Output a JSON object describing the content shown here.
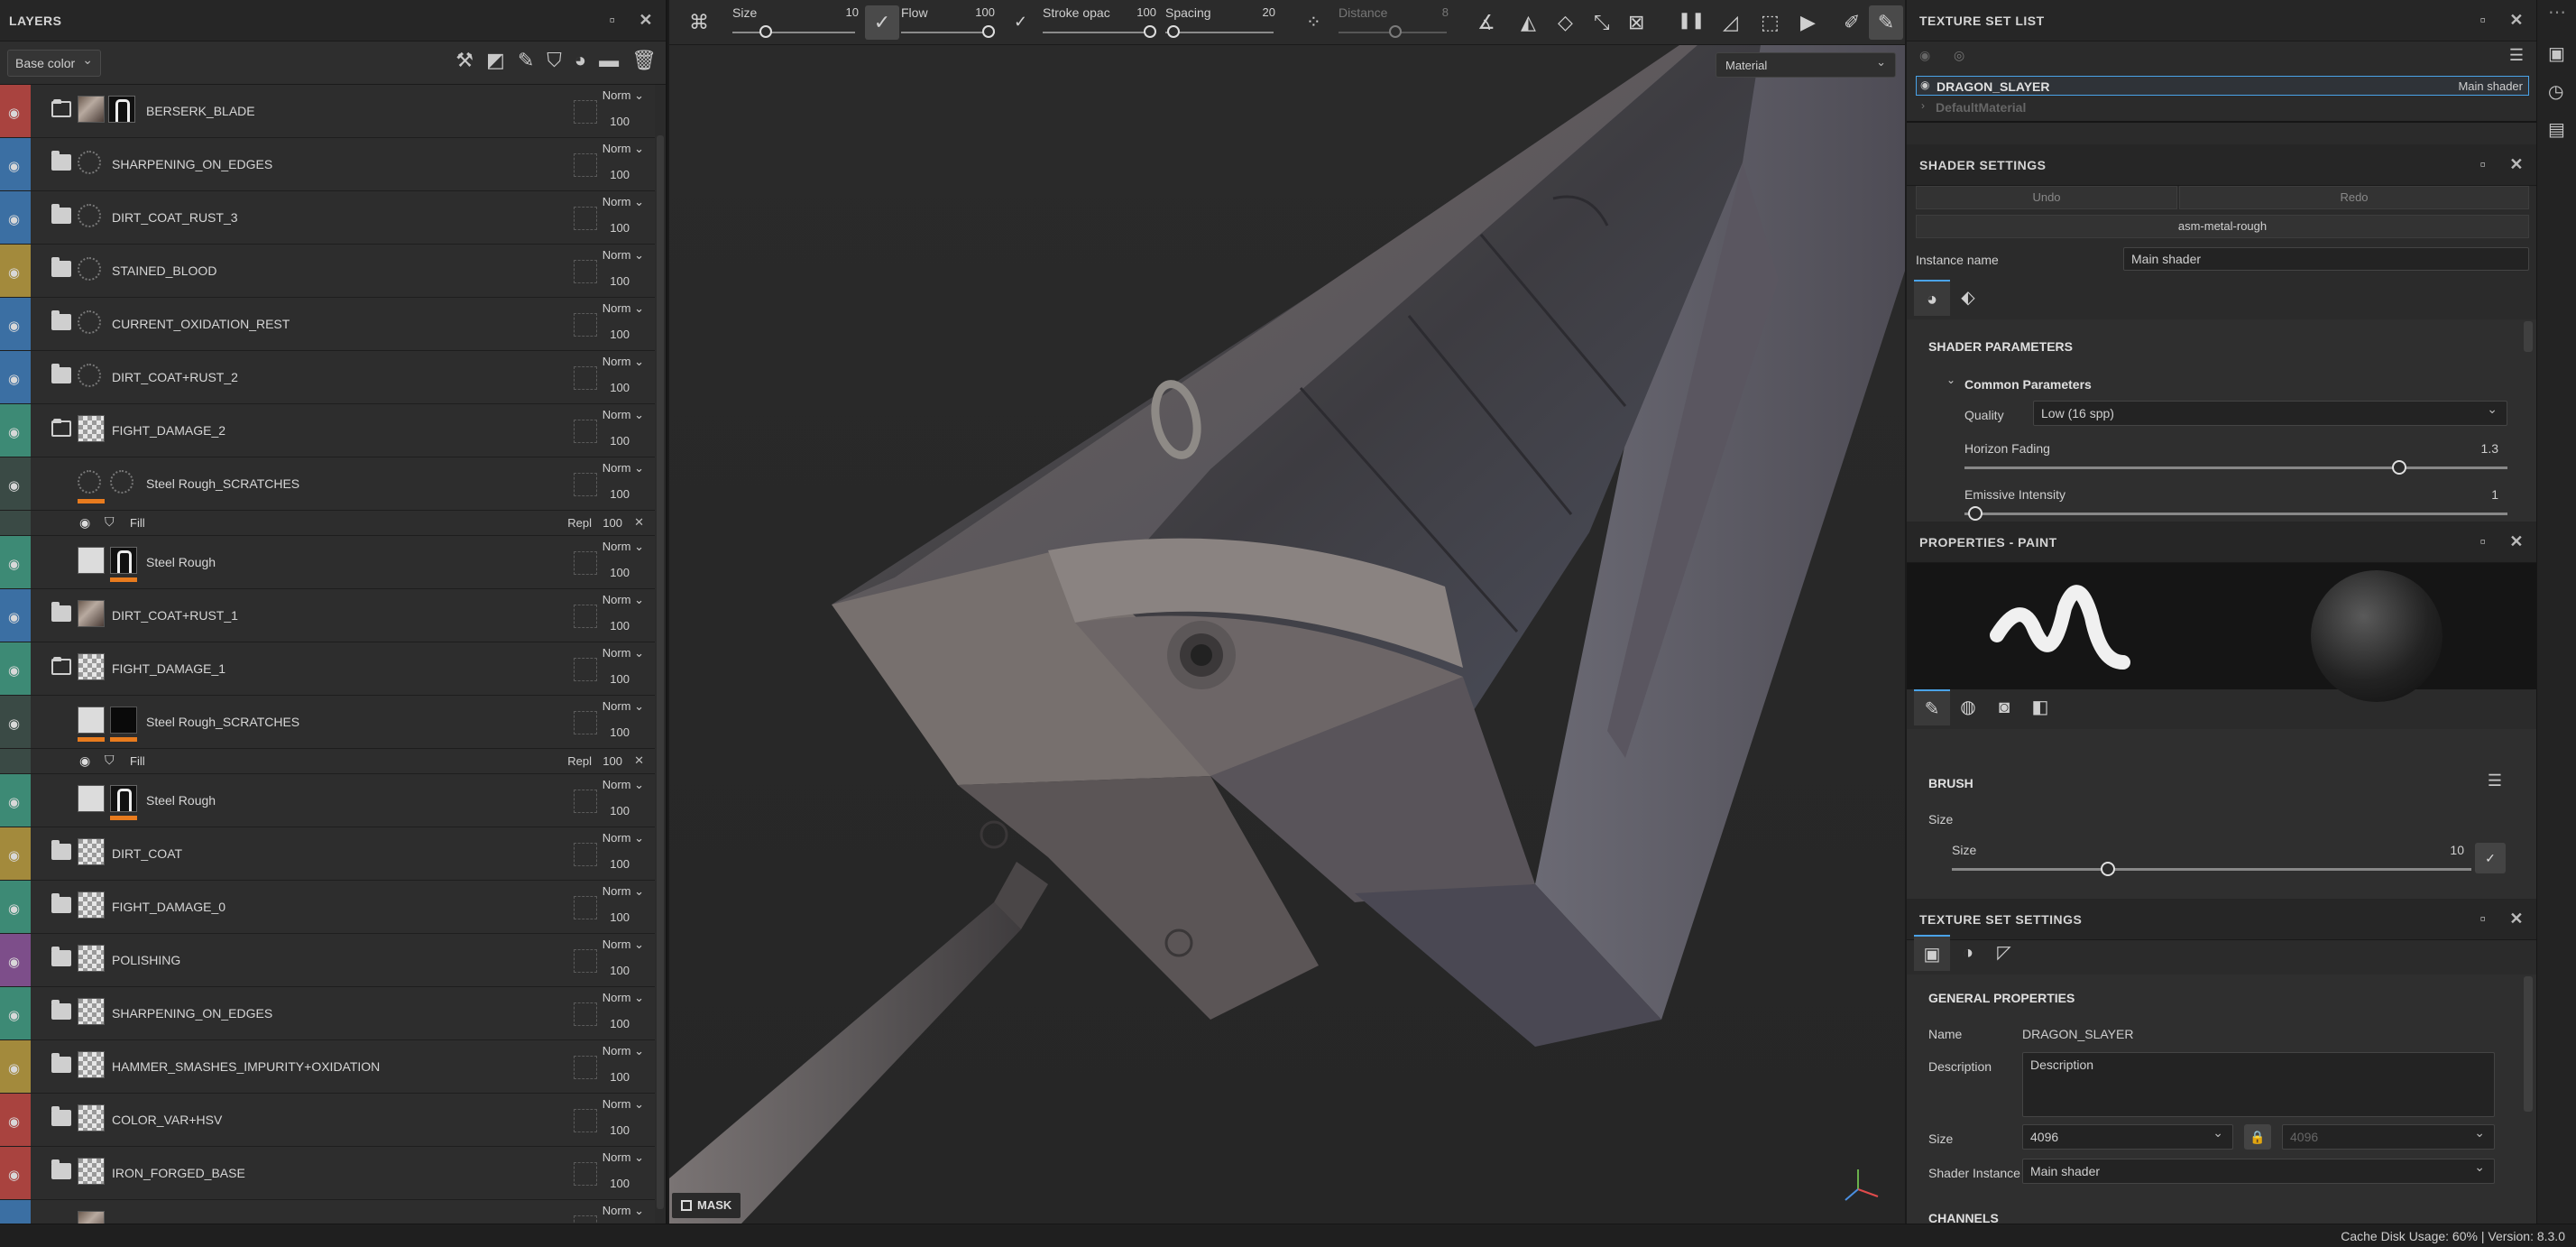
{
  "layers_panel": {
    "title": "LAYERS",
    "channel": "Base color",
    "layers": [
      {
        "name": "BERSERK_BLADE",
        "color": "#a9433f",
        "kind": "folder-open",
        "thumb": "pic",
        "mask": true,
        "blend": "Norm",
        "opacity": "100"
      },
      {
        "name": "SHARPENING_ON_EDGES",
        "color": "#3b6fa3",
        "kind": "folder",
        "thumb": "ring",
        "blend": "Norm",
        "opacity": "100"
      },
      {
        "name": "DIRT_COAT_RUST_3",
        "color": "#3b6fa3",
        "kind": "folder",
        "thumb": "ring",
        "blend": "Norm",
        "opacity": "100"
      },
      {
        "name": "STAINED_BLOOD",
        "color": "#a38a3c",
        "kind": "folder",
        "thumb": "ring",
        "blend": "Norm",
        "opacity": "100"
      },
      {
        "name": "CURRENT_OXIDATION_REST",
        "color": "#3b6fa3",
        "kind": "folder",
        "thumb": "ring",
        "blend": "Norm",
        "opacity": "100"
      },
      {
        "name": "DIRT_COAT+RUST_2",
        "color": "#3b6fa3",
        "kind": "folder",
        "thumb": "ring",
        "blend": "Norm",
        "opacity": "100"
      },
      {
        "name": "FIGHT_DAMAGE_2",
        "color": "#3d8a75",
        "kind": "folder-open",
        "thumb": "checker",
        "blend": "Norm",
        "opacity": "100"
      },
      {
        "name": "Steel Rough_SCRATCHES",
        "color": "#3a4a45",
        "kind": "fill-layer",
        "thumb": "ring",
        "thumb2": "ring",
        "orange": true,
        "blend": "Norm",
        "opacity": "100"
      },
      {
        "sub": true,
        "name": "Fill",
        "blend": "Repl",
        "opacity": "100"
      },
      {
        "name": "Steel Rough",
        "color": "#3d8a75",
        "kind": "layer",
        "thumb": "white",
        "thumb2": "mask",
        "orange2": true,
        "blend": "Norm",
        "opacity": "100"
      },
      {
        "name": "DIRT_COAT+RUST_1",
        "color": "#3b6fa3",
        "kind": "folder",
        "thumb": "pic",
        "blend": "Norm",
        "opacity": "100"
      },
      {
        "name": "FIGHT_DAMAGE_1",
        "color": "#3d8a75",
        "kind": "folder-open",
        "thumb": "checker",
        "blend": "Norm",
        "opacity": "100"
      },
      {
        "name": "Steel Rough_SCRATCHES",
        "color": "#3a4a45",
        "kind": "fill-layer",
        "thumb": "white",
        "thumb2": "dark",
        "orange": true,
        "orange2": true,
        "blend": "Norm",
        "opacity": "100"
      },
      {
        "sub": true,
        "name": "Fill",
        "blend": "Repl",
        "opacity": "100"
      },
      {
        "name": "Steel Rough",
        "color": "#3d8a75",
        "kind": "layer",
        "thumb": "white",
        "thumb2": "mask",
        "orange2": true,
        "blend": "Norm",
        "opacity": "100"
      },
      {
        "name": "DIRT_COAT",
        "color": "#a38a3c",
        "kind": "folder",
        "thumb": "checker",
        "blend": "Norm",
        "opacity": "100"
      },
      {
        "name": "FIGHT_DAMAGE_0",
        "color": "#3d8a75",
        "kind": "folder",
        "thumb": "checker",
        "blend": "Norm",
        "opacity": "100"
      },
      {
        "name": "POLISHING",
        "color": "#7d4e8a",
        "kind": "folder",
        "thumb": "checker",
        "blend": "Norm",
        "opacity": "100"
      },
      {
        "name": "SHARPENING_ON_EDGES",
        "color": "#3d8a75",
        "kind": "folder",
        "thumb": "checker",
        "blend": "Norm",
        "opacity": "100"
      },
      {
        "name": "HAMMER_SMASHES_IMPURITY+OXIDATION",
        "color": "#a38a3c",
        "kind": "folder",
        "thumb": "checker",
        "blend": "Norm",
        "opacity": "100"
      },
      {
        "name": "COLOR_VAR+HSV",
        "color": "#a9433f",
        "kind": "folder",
        "thumb": "checker",
        "blend": "Norm",
        "opacity": "100"
      },
      {
        "name": "IRON_FORGED_BASE",
        "color": "#a9433f",
        "kind": "folder",
        "thumb": "checker",
        "blend": "Norm",
        "opacity": "100"
      },
      {
        "name": "",
        "color": "#3b6fa3",
        "kind": "layer",
        "thumb": "pic",
        "blend": "Norm",
        "opacity": ""
      }
    ]
  },
  "toolbar": {
    "size_label": "Size",
    "size_value": "10",
    "flow_label": "Flow",
    "flow_value": "100",
    "stroke_label": "Stroke opac",
    "stroke_value": "100",
    "spacing_label": "Spacing",
    "spacing_value": "20",
    "distance_label": "Distance",
    "distance_value": "8"
  },
  "viewport": {
    "material_mode": "Material",
    "mask_label": "MASK"
  },
  "texture_set_list": {
    "title": "TEXTURE SET LIST",
    "items": [
      {
        "name": "DRAGON_SLAYER",
        "shader": "Main shader"
      },
      {
        "name": "DefaultMaterial",
        "shader": ""
      }
    ]
  },
  "shader_settings": {
    "title": "SHADER SETTINGS",
    "undo": "Undo",
    "redo": "Redo",
    "shader": "asm-metal-rough",
    "instance_label": "Instance name",
    "instance_value": "Main shader",
    "params_title": "SHADER PARAMETERS",
    "common": "Common Parameters",
    "quality_label": "Quality",
    "quality_value": "Low (16 spp)",
    "horizon_label": "Horizon Fading",
    "horizon_value": "1.3",
    "horizon_level": 0.8,
    "emissive_label": "Emissive Intensity",
    "emissive_value": "1",
    "emissive_level": 0.02
  },
  "properties_paint": {
    "title": "PROPERTIES - PAINT",
    "brush_title": "BRUSH",
    "size_group": "Size",
    "size_label": "Size",
    "size_value": "10",
    "size_level": 0.3
  },
  "texture_set_settings": {
    "title": "TEXTURE SET SETTINGS",
    "general": "GENERAL PROPERTIES",
    "name_label": "Name",
    "name_value": "DRAGON_SLAYER",
    "desc_label": "Description",
    "desc_value": "Description",
    "size_label": "Size",
    "size_value": "4096",
    "size_value2": "4096",
    "shader_label": "Shader Instance",
    "shader_value": "Main shader",
    "next_section": "CHANNELS"
  },
  "status": {
    "text": "Cache Disk Usage:  60% | Version: 8.3.0"
  }
}
